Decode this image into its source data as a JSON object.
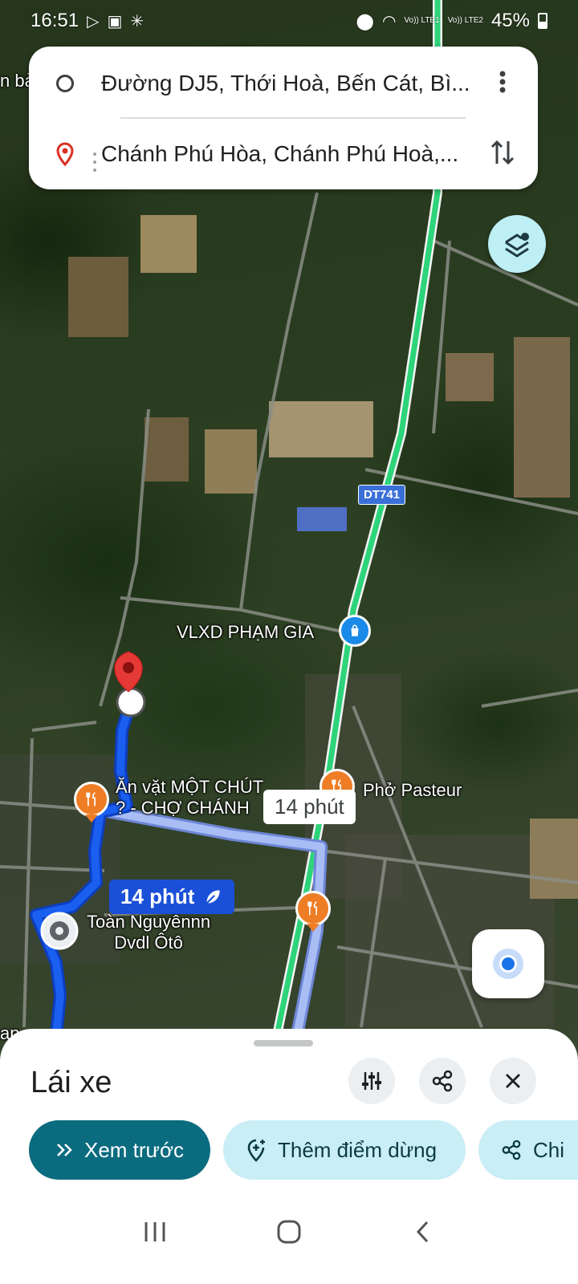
{
  "status_bar": {
    "time": "16:51",
    "lte1": "Vo)) LTE1",
    "lte2": "Vo)) LTE2",
    "battery": "45%"
  },
  "directions": {
    "origin": "Đường DJ5, Thới Hoà, Bến Cát, Bì...",
    "destination": "Chánh Phú Hòa, Chánh Phú Hoà,..."
  },
  "map": {
    "edge_label_top": "n bả",
    "edge_label_bottom": "ap",
    "road_shield": "DT741",
    "poi_vlxd": "VLXD PHẠM GIA",
    "poi_anvat_line1": "Ăn vặt MỘT CHÚT",
    "poi_anvat_line2": "? - CHỢ CHÁNH",
    "poi_pho": "Phở Pasteur",
    "poi_toan_line1": "Toàn Nguyênnn",
    "poi_toan_line2": "Dvdl Ôtô",
    "route_time_primary": "14 phút",
    "route_time_alt": "14 phút",
    "colors": {
      "route_primary": "#1a5ff0",
      "route_alt": "#a9bdf5",
      "traffic_green": "#2ed47a",
      "poi_orange": "#ee7d25"
    }
  },
  "sheet": {
    "title": "Lái xe",
    "preview_label": "Xem trước",
    "add_stop_label": "Thêm điểm dừng",
    "share_chip_label": "Chi"
  },
  "icons": {
    "origin": "origin-circle-icon",
    "destination": "destination-pin-icon",
    "more": "more-vert-icon",
    "swap": "swap-vertical-icon",
    "layers": "layers-icon",
    "my_location": "my-location-icon",
    "options": "tune-icon",
    "share": "share-icon",
    "close": "close-icon"
  }
}
